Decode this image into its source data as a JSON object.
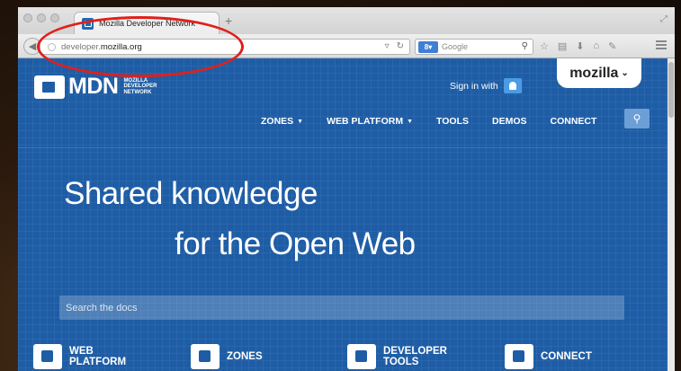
{
  "browser": {
    "tab_title": "Mozilla Developer Network",
    "new_tab_label": "+",
    "url_prefix": "developer.",
    "url_domain": "mozilla.org",
    "search_engine_badge": "8",
    "search_placeholder": "Google"
  },
  "header": {
    "logo_text": "MDN",
    "logo_sub_line1": "MOZILLA",
    "logo_sub_line2": "DEVELOPER",
    "logo_sub_line3": "NETWORK",
    "sign_in_label": "Sign in with",
    "mozilla_label": "mozilla"
  },
  "nav": {
    "items": [
      {
        "label": "ZONES"
      },
      {
        "label": "WEB PLATFORM"
      },
      {
        "label": "TOOLS"
      },
      {
        "label": "DEMOS"
      },
      {
        "label": "CONNECT"
      }
    ]
  },
  "hero": {
    "line1": "Shared knowledge",
    "line2": "for the Open Web"
  },
  "search": {
    "placeholder": "Search the docs"
  },
  "features": [
    {
      "line1": "WEB",
      "line2": "PLATFORM"
    },
    {
      "line1": "ZONES",
      "line2": ""
    },
    {
      "line1": "DEVELOPER",
      "line2": "TOOLS"
    },
    {
      "line1": "CONNECT",
      "line2": ""
    }
  ],
  "colors": {
    "page_blue": "#1e5da5",
    "annotation_red": "#e0201b"
  }
}
